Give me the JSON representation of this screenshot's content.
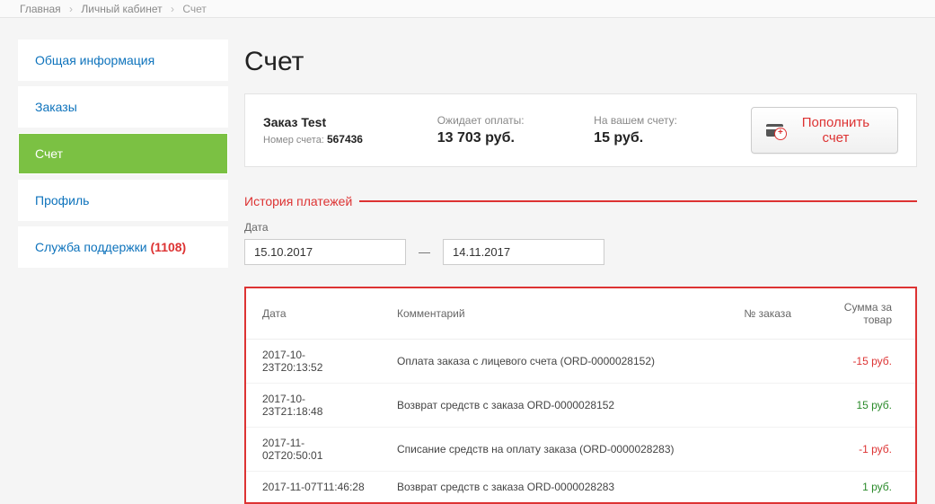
{
  "breadcrumb": {
    "items": [
      "Главная",
      "Личный кабинет",
      "Счет"
    ]
  },
  "sidebar": {
    "items": [
      {
        "label": "Общая информация",
        "active": false
      },
      {
        "label": "Заказы",
        "active": false
      },
      {
        "label": "Счет",
        "active": true
      },
      {
        "label": "Профиль",
        "active": false
      },
      {
        "label": "Служба поддержки",
        "active": false,
        "count": "(1108)"
      }
    ]
  },
  "page": {
    "title": "Счет"
  },
  "summary": {
    "order_name": "Заказ Test",
    "account_label": "Номер счета:",
    "account_number": "567436",
    "pending_label": "Ожидает оплаты:",
    "pending_value": "13 703 руб.",
    "balance_label": "На вашем счету:",
    "balance_value": "15 руб.",
    "topup_label": "Пополнить счет"
  },
  "history": {
    "section_title": "История платежей",
    "date_label": "Дата",
    "date_from": "15.10.2017",
    "date_dash": "—",
    "date_to": "14.11.2017",
    "columns": {
      "date": "Дата",
      "comment": "Комментарий",
      "order": "№ заказа",
      "sum": "Сумма за товар"
    },
    "rows": [
      {
        "date": "2017-10-23T20:13:52",
        "comment": "Оплата заказа с лицевого счета (ORD-0000028152)",
        "order": "",
        "sum": "-15 руб.",
        "sign": "neg"
      },
      {
        "date": "2017-10-23T21:18:48",
        "comment": "Возврат средств с заказа ORD-0000028152",
        "order": "",
        "sum": "15 руб.",
        "sign": "pos"
      },
      {
        "date": "2017-11-02T20:50:01",
        "comment": "Списание средств на оплату заказа (ORD-0000028283)",
        "order": "",
        "sum": "-1 руб.",
        "sign": "neg"
      },
      {
        "date": "2017-11-07T11:46:28",
        "comment": "Возврат средств с заказа ORD-0000028283",
        "order": "",
        "sum": "1 руб.",
        "sign": "pos"
      }
    ]
  }
}
